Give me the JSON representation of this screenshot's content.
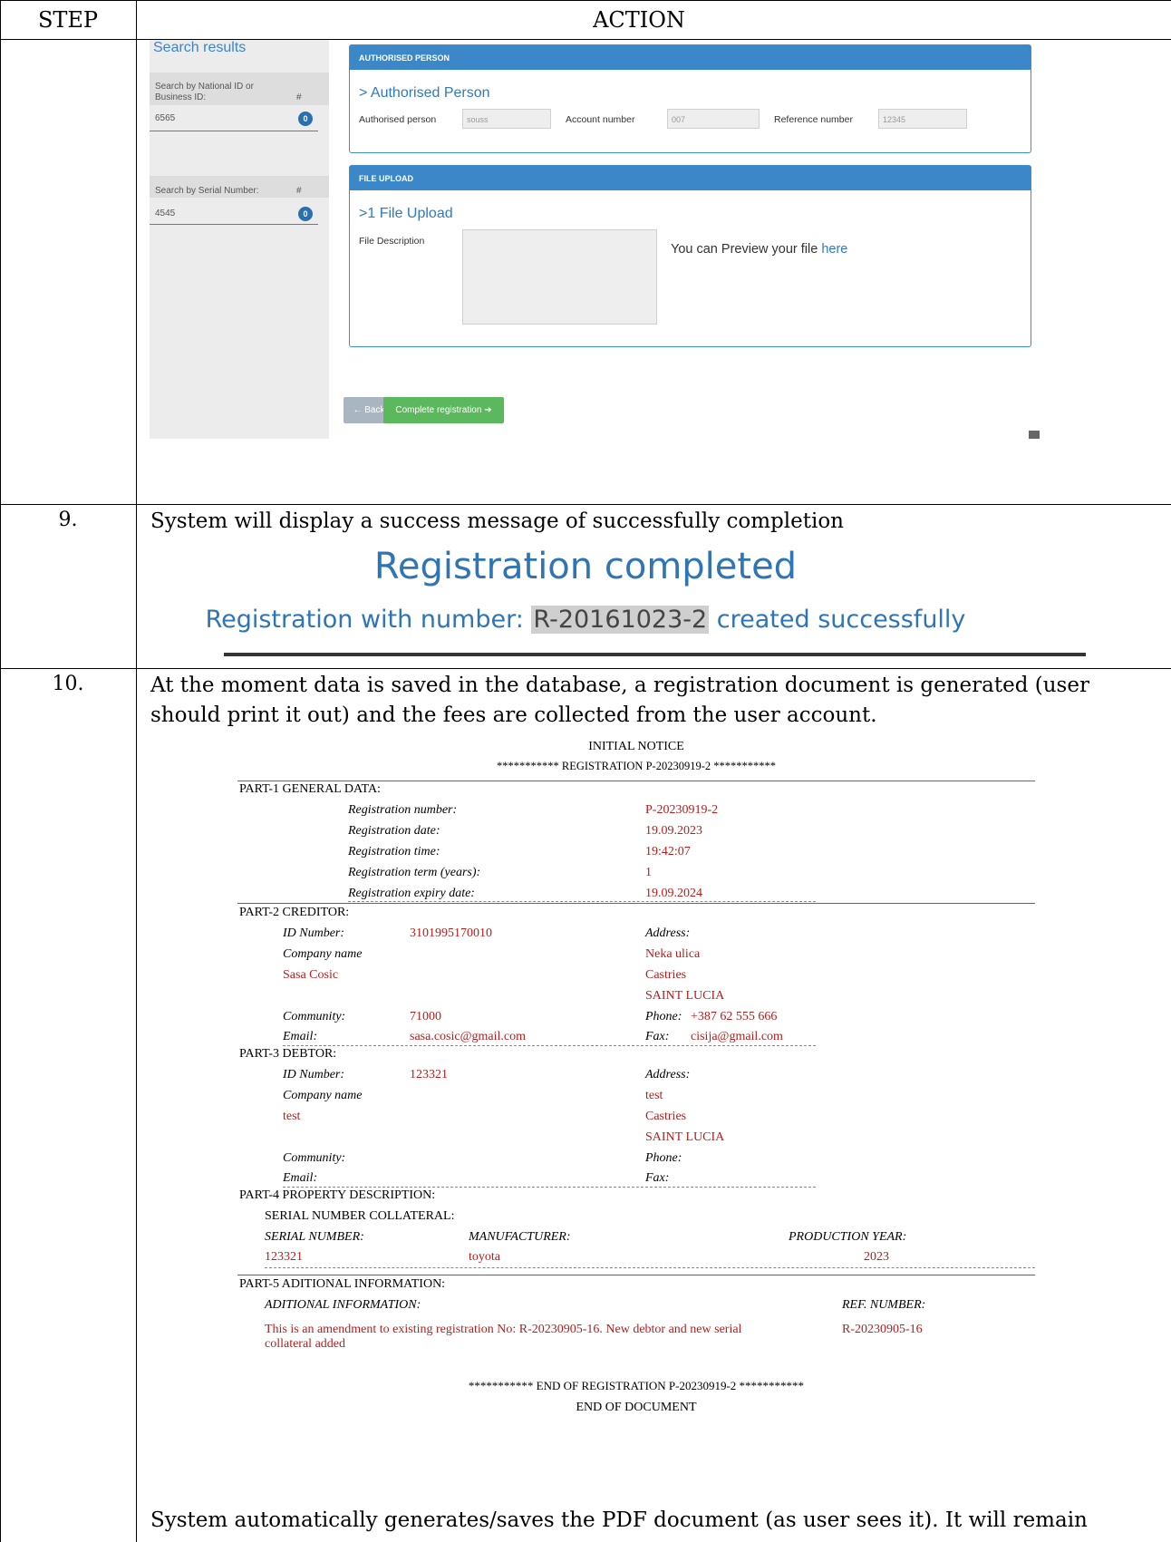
{
  "table": {
    "step_header": "STEP",
    "action_header": "ACTION"
  },
  "screen": {
    "sidebar": {
      "title": "Search results",
      "national_label": "Search by National ID or Business ID:",
      "hash1": "#",
      "national_value": "6565",
      "national_count": "0",
      "serial_label": "Search by Serial Number:",
      "hash2": "#",
      "serial_value": "4545",
      "serial_count": "0"
    },
    "authorised": {
      "header": "AUTHORISED PERSON",
      "title": "> Authorised Person",
      "person_label": "Authorised person",
      "person_value": "souss",
      "account_label": "Account number",
      "account_value": "007",
      "reference_label": "Reference number",
      "reference_value": "12345"
    },
    "upload": {
      "header": "FILE UPLOAD",
      "title": ">1    File Upload",
      "desc_label": "File Description",
      "preview_text": "You can Preview your file ",
      "preview_link": "here"
    },
    "buttons": {
      "back": "← Back",
      "complete": "Complete registration ➔"
    }
  },
  "step9": {
    "number": "9.",
    "text": "System will display a success message of successfully completion",
    "title": "Registration completed",
    "sub_prefix": "Registration with number: ",
    "reg_number": "R-20161023-2",
    "sub_suffix": " created successfully"
  },
  "step10": {
    "number": "10.",
    "text": "At the moment data is saved in the database, a registration document is generated (user should print it out) and the fees are collected from the user account.",
    "footer_text": "System automatically generates/saves the PDF document (as user sees it). It will remain"
  },
  "pdf": {
    "title": "INITIAL NOTICE",
    "reg_line": "***********    REGISTRATION  P-20230919-2    ***********",
    "part1": {
      "heading": "PART-1 GENERAL DATA:",
      "rows": [
        {
          "label": "Registration number:",
          "value": "P-20230919-2"
        },
        {
          "label": "Registration date:",
          "value": "19.09.2023"
        },
        {
          "label": "Registration time:",
          "value": "19:42:07"
        },
        {
          "label": "Registration term (years):",
          "value": "1"
        },
        {
          "label": "Registration expiry date:",
          "value": "19.09.2024"
        }
      ]
    },
    "part2": {
      "heading": "PART-2 CREDITOR:",
      "id_label": "ID Number:",
      "id_value": "3101995170010",
      "address_label": "Address:",
      "company_label": "Company name",
      "company_value": "Sasa Cosic",
      "address_lines": [
        "Neka ulica",
        "Castries",
        "SAINT LUCIA"
      ],
      "community_label": "Community:",
      "community_value": "71000",
      "phone_label": "Phone:",
      "phone_value": "+387 62 555 666",
      "email_label": "Email:",
      "email_value": "sasa.cosic@gmail.com",
      "fax_label": "Fax:",
      "fax_value": "cisija@gmail.com"
    },
    "part3": {
      "heading": "PART-3 DEBTOR:",
      "id_label": "ID Number:",
      "id_value": "123321",
      "address_label": "Address:",
      "company_label": "Company name",
      "company_value": "test",
      "address_lines": [
        "test",
        "Castries",
        "SAINT LUCIA"
      ],
      "community_label": "Community:",
      "phone_label": "Phone:",
      "email_label": "Email:",
      "fax_label": "Fax:"
    },
    "part4": {
      "heading": "PART-4 PROPERTY DESCRIPTION:",
      "sub": "SERIAL NUMBER COLLATERAL:",
      "serial_label": "SERIAL NUMBER:",
      "serial_value": "123321",
      "manufacturer_label": "MANUFACTURER:",
      "manufacturer_value": "toyota",
      "year_label": "PRODUCTION YEAR:",
      "year_value": "2023"
    },
    "part5": {
      "heading": "PART-5 ADITIONAL INFORMATION:",
      "info_label": "ADITIONAL INFORMATION:",
      "ref_label": "REF. NUMBER:",
      "info_line1": "This is an amendment to existing registration No: R-20230905-16. New debtor and new serial",
      "info_line2": "collateral added",
      "ref_value": "R-20230905-16"
    },
    "end_line": "***********    END OF REGISTRATION  P-20230919-2    ***********",
    "end_doc": "END OF DOCUMENT"
  }
}
